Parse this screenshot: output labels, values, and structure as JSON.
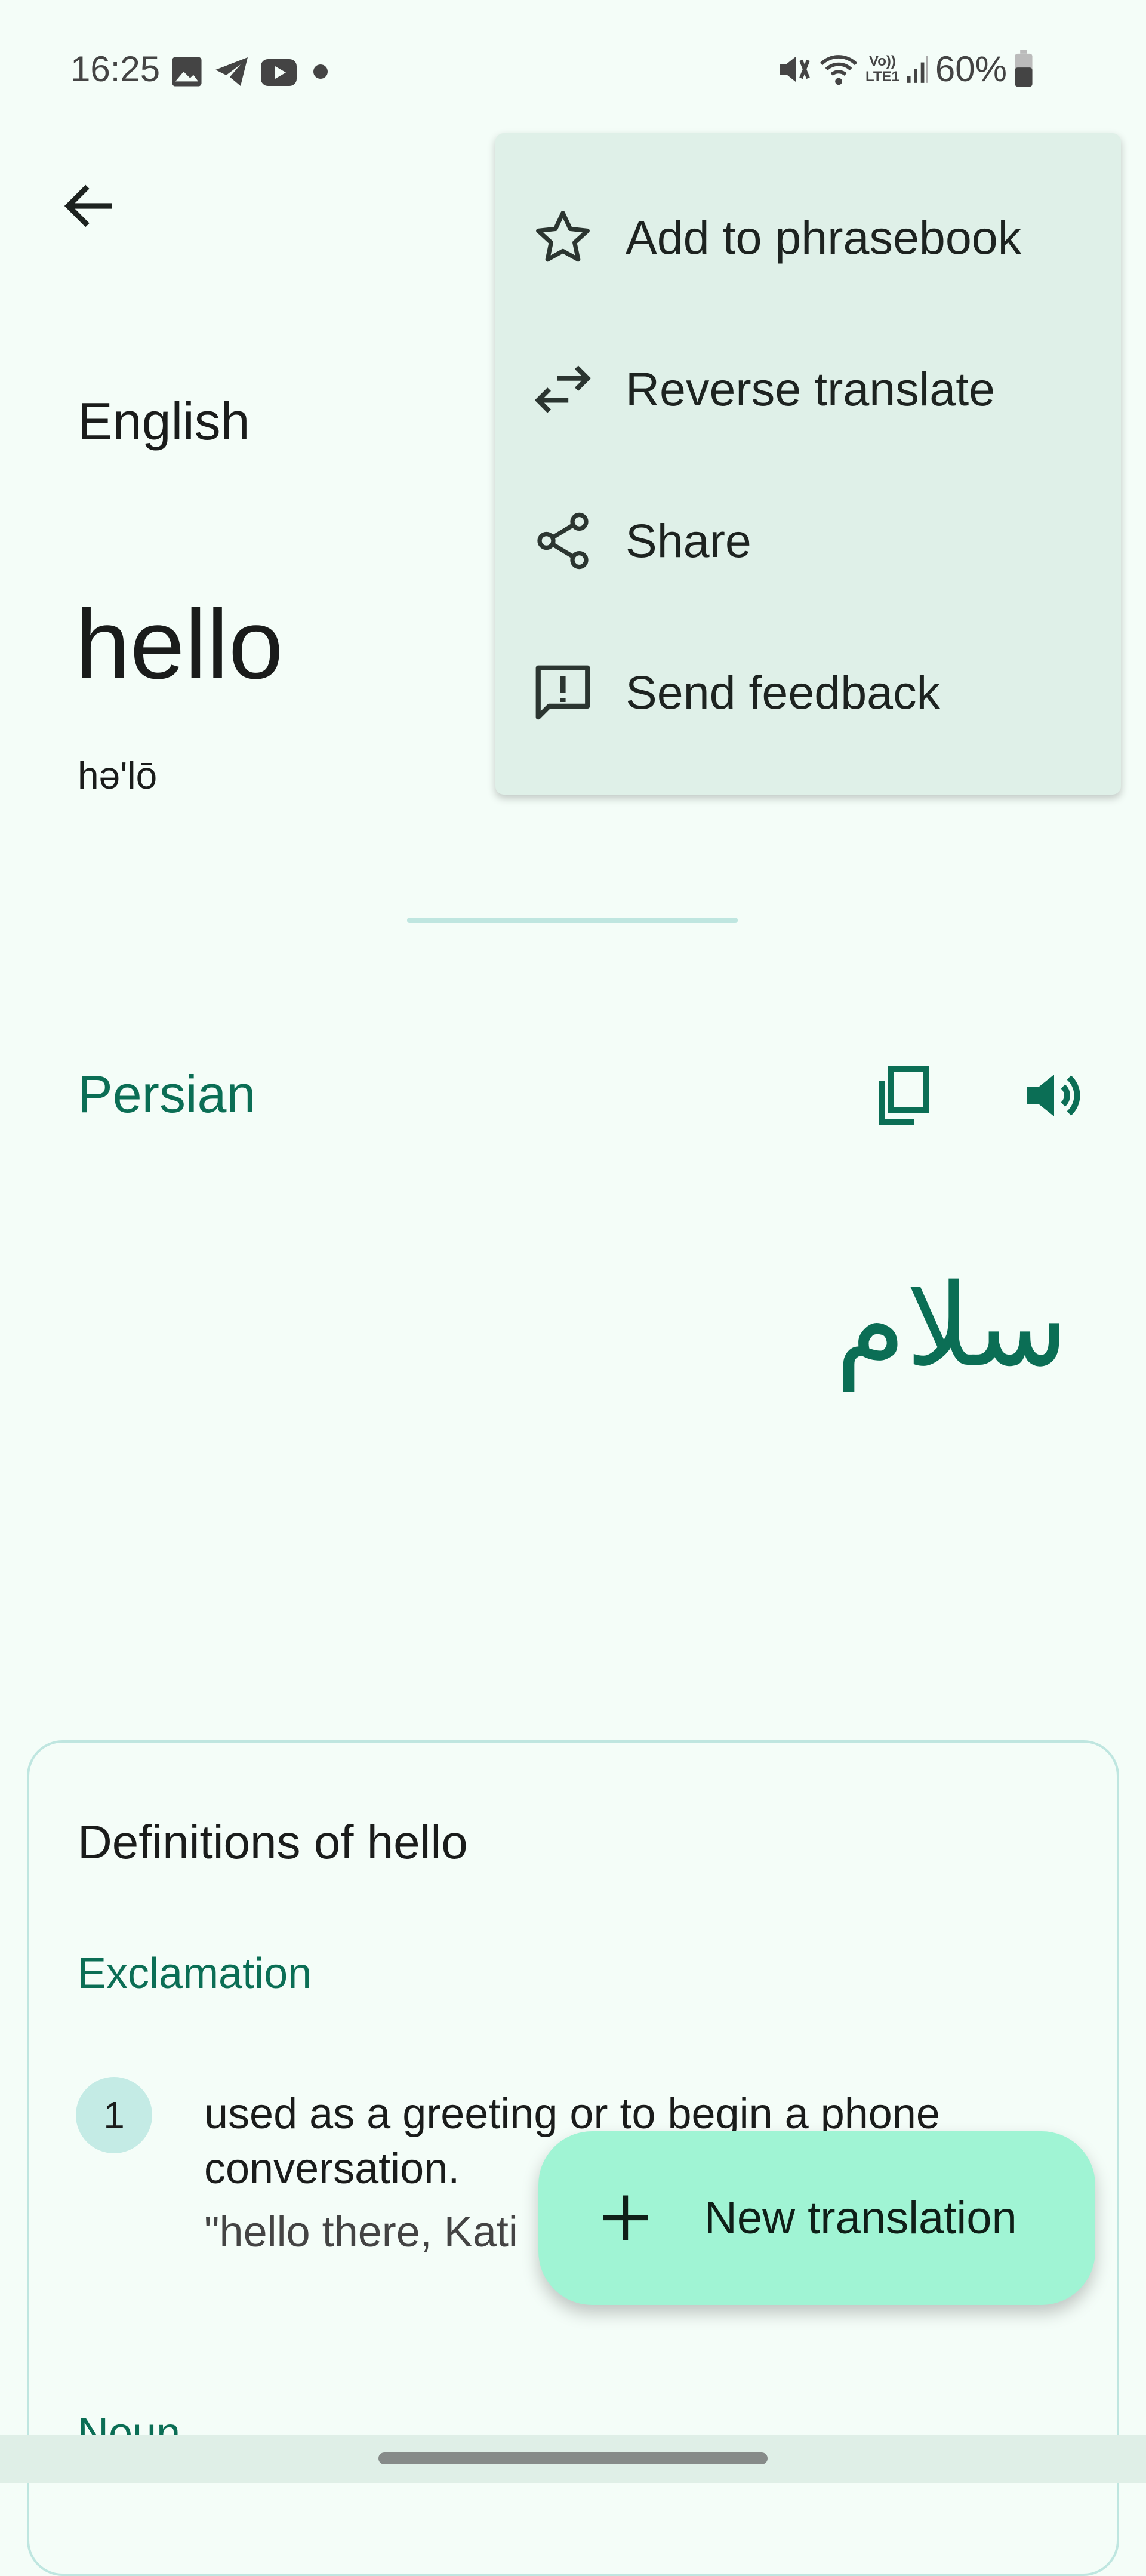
{
  "status_bar": {
    "time": "16:25",
    "battery": "60%",
    "notification_icons": [
      "image-icon",
      "telegram-icon",
      "youtube-icon",
      "dot-icon"
    ],
    "system_icons": [
      "mute-icon",
      "wifi-icon",
      "volte-icon",
      "signal-icon",
      "battery-icon"
    ],
    "volte_label_top": "Vo))",
    "volte_label_bottom": "LTE1"
  },
  "header": {
    "back_icon": "arrow-left-icon"
  },
  "menu": {
    "items": [
      {
        "label": "Add to phrasebook",
        "icon": "star-icon"
      },
      {
        "label": "Reverse translate",
        "icon": "swap-icon"
      },
      {
        "label": "Share",
        "icon": "share-icon"
      },
      {
        "label": "Send feedback",
        "icon": "feedback-icon"
      }
    ]
  },
  "source": {
    "language": "English",
    "text": "hello",
    "pronunciation": "hə'lō"
  },
  "target": {
    "language": "Persian",
    "text": "سلام"
  },
  "definitions": {
    "title": "Definitions of hello",
    "pos": "Exclamation",
    "items": [
      {
        "number": "1",
        "text_line1": "used as a greeting or to begin a phone",
        "text_line2": "conversation.",
        "example": "\"hello there, Kati"
      }
    ],
    "next_pos": "Noun"
  },
  "fab": {
    "label": "New translation"
  },
  "colors": {
    "accent": "#0b6e55",
    "background": "#f4fdf8",
    "menu": "#dff0e8",
    "fab": "#a0f4d4"
  }
}
